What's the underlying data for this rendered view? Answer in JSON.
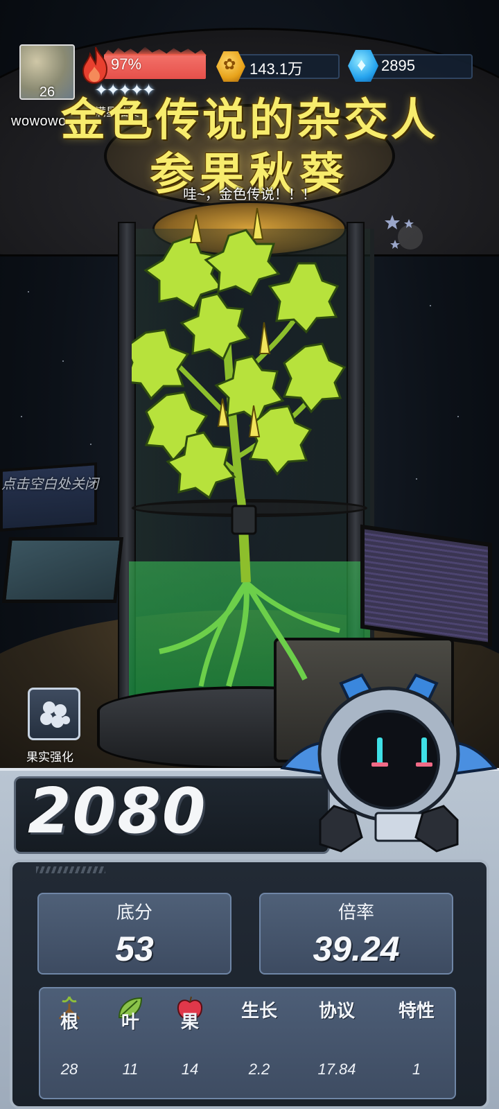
{
  "player": {
    "level": "26",
    "name": "wowowo"
  },
  "energy": {
    "percent": "97%",
    "fill": 0.97,
    "stars_label": "满星抽奖",
    "stars": "✦✦✦✦✦"
  },
  "resources": {
    "coins": "143.1万",
    "gems": "2895"
  },
  "result": {
    "title_line1": "金色传说的杂交人",
    "title_line2": "参果秋葵",
    "subtitle": "哇~，金色传说！！！",
    "close_hint": "点击空白处关闭"
  },
  "fruit_button": {
    "label": "果实强化"
  },
  "score": {
    "total": "2080",
    "base_label": "底分",
    "base_value": "53",
    "multiplier_label": "倍率",
    "multiplier_value": "39.24"
  },
  "attributes": [
    {
      "name": "根",
      "value": "28",
      "icon": "root-icon"
    },
    {
      "name": "叶",
      "value": "11",
      "icon": "leaf-icon"
    },
    {
      "name": "果",
      "value": "14",
      "icon": "apple-icon"
    },
    {
      "name": "生长",
      "value": "2.2"
    },
    {
      "name": "协议",
      "value": "17.84"
    },
    {
      "name": "特性",
      "value": "1"
    }
  ],
  "colors": {
    "title": "#f7ec6d",
    "energy": "#e6504a",
    "panel": "#222a35",
    "card": "#4f6078",
    "liquid": "#2fbf5c"
  }
}
